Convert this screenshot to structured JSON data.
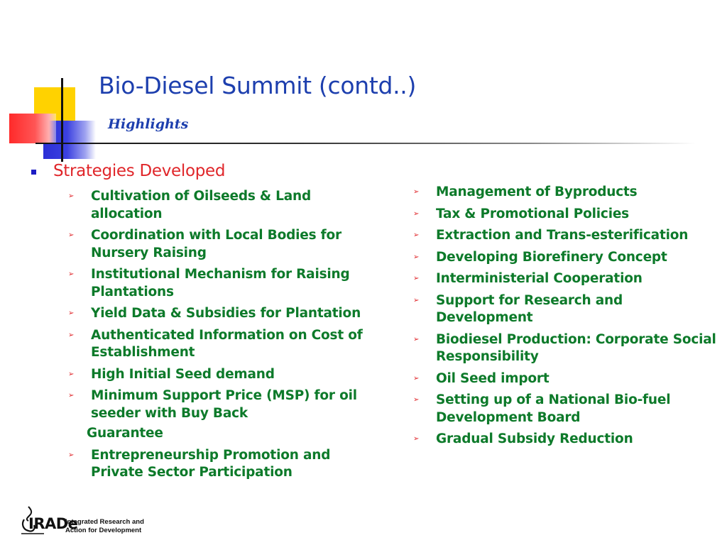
{
  "slide": {
    "title": "Bio-Diesel Summit (contd..)",
    "subtitle": "Highlights",
    "section_heading": "Strategies Developed",
    "bullet_glyph": "➢",
    "left_items": [
      "Cultivation of Oilseeds & Land allocation",
      "Coordination with Local Bodies for Nursery Raising",
      "Institutional Mechanism for Raising Plantations",
      "Yield Data & Subsidies for Plantation",
      "Authenticated Information on Cost of Establishment",
      "High Initial Seed demand",
      "Minimum Support Price (MSP) for oil seeder with Buy Back",
      "Entrepreneurship Promotion and Private Sector Participation"
    ],
    "left_continuation": "Guarantee",
    "right_items": [
      "Management of Byproducts",
      "Tax & Promotional Policies",
      "Extraction and Trans-esterification",
      "Developing Biorefinery Concept",
      "Interministerial Cooperation",
      "Support for Research and Development",
      "Biodiesel Production: Corporate Social Responsibility",
      "Oil Seed import",
      "Setting up of a National Bio-fuel Development Board",
      "Gradual Subsidy Reduction"
    ]
  },
  "logo": {
    "name": "IRADe",
    "line1": "Integrated Research and",
    "line2": "Action for Development"
  },
  "colors": {
    "title": "#1d3fae",
    "heading": "#e0262a",
    "items": "#0d7a2a",
    "deco_yellow": "#ffd200",
    "deco_blue": "#2b2fd6",
    "deco_red": "#ff2a2a"
  }
}
